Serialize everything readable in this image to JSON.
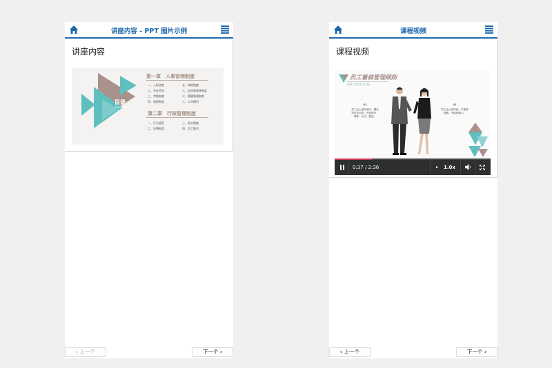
{
  "left_phone": {
    "header_title": "讲座内容 - PPT 图片示例",
    "content_heading": "讲座内容",
    "slide": {
      "mulu": "目录",
      "mulu_sub": "Contents",
      "chapter1": "第一章　人事管理制度",
      "chapter1_items": [
        "一、入职流程",
        "五、休假制度",
        "二、劳动合同",
        "六、加班和调休制度",
        "三、考勤制度",
        "七、薪酬管理制度",
        "四、请假制度",
        "八、公司福利"
      ],
      "chapter2": "第二章　行政管理制度",
      "chapter2_items": [
        "一、行为规范",
        "三、发文制度",
        "二、应聘制度",
        "四、员工意识"
      ]
    },
    "prev_label": "上一个",
    "next_label": "下一个"
  },
  "right_phone": {
    "header_title": "课程视频",
    "content_heading": "课程视频",
    "video": {
      "slide_title": "员工着装管理细则",
      "slide_subtitle": "ADD YOUR TITLE",
      "text_left_head": "01",
      "text_left": "员工出上班时间内，要注意仪容仪表，衣冠整齐，得体、大方、整洁。",
      "text_right_head": "02",
      "text_right": "员工出上班时间，不能穿短裤，不能穿够心。",
      "time": "0:37 / 2:36",
      "speed": "1.0x",
      "progress": 0.237
    },
    "prev_label": "上一个",
    "next_label": "下一个"
  },
  "colors": {
    "accent_blue": "#1f68ad",
    "teal": "#5fbfbf",
    "taupe": "#a8928b",
    "progress_red": "#cc3b5b"
  },
  "icons": [
    "home-icon",
    "menu-icon",
    "pause-icon",
    "volume-icon",
    "fullscreen-icon",
    "chevron-left-icon",
    "chevron-right-icon"
  ]
}
